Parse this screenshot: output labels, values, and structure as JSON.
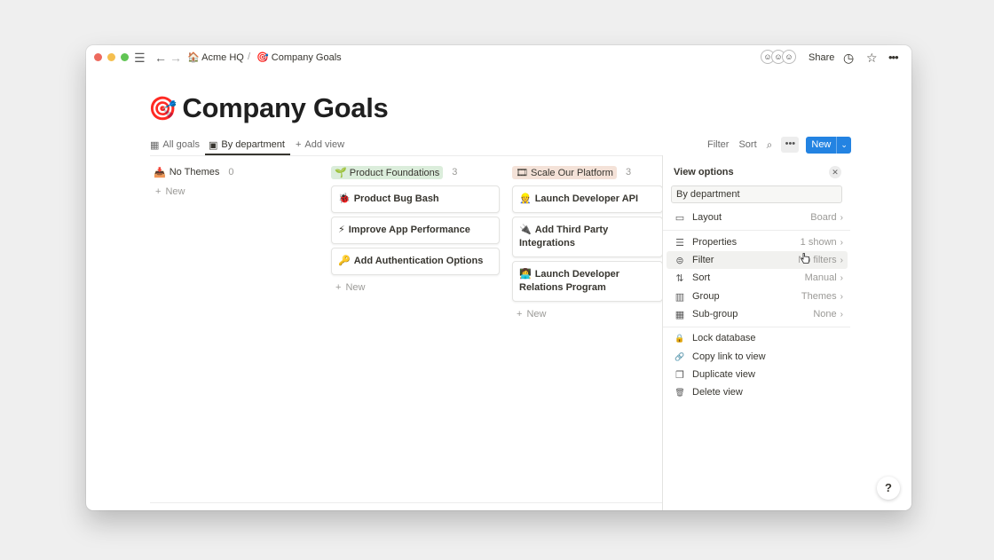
{
  "titlebar": {
    "breadcrumb": [
      {
        "emoji": "🏠",
        "label": "Acme HQ"
      },
      {
        "emoji": "🎯",
        "label": "Company Goals"
      }
    ],
    "separator": "/",
    "share_label": "Share",
    "icons": [
      "menu-icon",
      "back-arrow-icon",
      "forward-arrow-icon",
      "clock-icon",
      "star-icon",
      "more-icon"
    ]
  },
  "page": {
    "emoji": "🎯",
    "title": "Company Goals"
  },
  "views": {
    "tabs": [
      {
        "icon": "▦",
        "label": "All goals"
      },
      {
        "icon": "▣",
        "label": "By department"
      }
    ],
    "add_view_label": "Add view",
    "toolbar": {
      "filter_label": "Filter",
      "sort_label": "Sort",
      "more_label": "•••",
      "new_label": "New"
    }
  },
  "board": {
    "columns": [
      {
        "emoji": "📥",
        "name": "No Themes",
        "count": "0",
        "tag_color": "#ffffff",
        "cards": [],
        "new_label": "New"
      },
      {
        "emoji": "🌱",
        "name": "Product Foundations",
        "count": "3",
        "tag_color": "#dbeddb",
        "cards": [
          {
            "emoji": "🐞",
            "title": "Product Bug Bash"
          },
          {
            "emoji": "⚡",
            "title": "Improve App Performance"
          },
          {
            "emoji": "🔑",
            "title": "Add Authentication Options"
          }
        ],
        "new_label": "New"
      },
      {
        "emoji": "🎞",
        "name": "Scale Our Platform",
        "count": "3",
        "tag_color": "#f4e2d8",
        "cards": [
          {
            "emoji": "👷",
            "title": "Launch Developer API"
          },
          {
            "emoji": "🔌",
            "title": "Add Third Party Integrations"
          },
          {
            "emoji": "👩‍💻",
            "title": "Launch Developer Relations Program"
          }
        ],
        "new_label": "New"
      }
    ]
  },
  "view_options": {
    "title": "View options",
    "view_name": "By department",
    "settings": [
      {
        "icon": "layout-icon",
        "glyph": "▭",
        "label": "Layout",
        "value": "Board"
      },
      {
        "icon": "properties-icon",
        "glyph": "☰",
        "label": "Properties",
        "value": "1 shown"
      },
      {
        "icon": "filter-icon",
        "glyph": "⊜",
        "label": "Filter",
        "value": "No filters"
      },
      {
        "icon": "sort-icon",
        "glyph": "⇅",
        "label": "Sort",
        "value": "Manual"
      },
      {
        "icon": "group-icon",
        "glyph": "▥",
        "label": "Group",
        "value": "Themes"
      },
      {
        "icon": "subgroup-icon",
        "glyph": "▦",
        "label": "Sub-group",
        "value": "None"
      }
    ],
    "actions": [
      {
        "icon": "lock-icon",
        "glyph": "🔒",
        "label": "Lock database"
      },
      {
        "icon": "link-icon",
        "glyph": "🔗",
        "label": "Copy link to view"
      },
      {
        "icon": "duplicate-icon",
        "glyph": "❐",
        "label": "Duplicate view"
      },
      {
        "icon": "trash-icon",
        "glyph": "🗑",
        "label": "Delete view"
      }
    ]
  },
  "help_label": "?",
  "colors": {
    "accent": "#2383e2",
    "text": "#37352f",
    "muted": "#9b9a97"
  }
}
